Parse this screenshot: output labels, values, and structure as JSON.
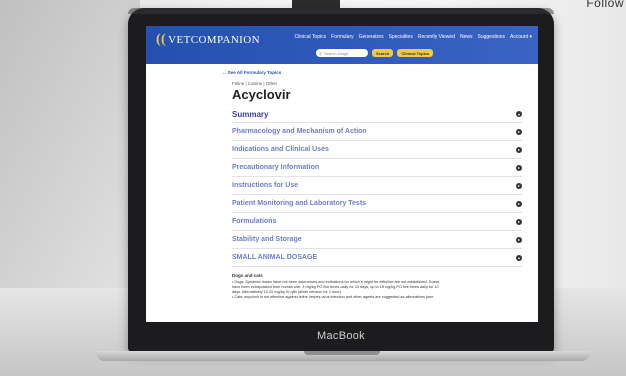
{
  "backdrop": {
    "corner_text": "Follow"
  },
  "device": {
    "brand": "MacBook"
  },
  "site": {
    "logo_text": "VETCOMPANION",
    "nav": [
      "Clinical Topics",
      "Formulary",
      "Generators",
      "Specialties",
      "Recently Viewed",
      "News",
      "Suggestions",
      "Account ▾"
    ],
    "search_placeholder": "Search Drugs",
    "search_button": "Search",
    "clinical_button": "Clinical Topics"
  },
  "page": {
    "back_link": "← See All Formulary Topics",
    "species": "Feline | Canine | Other",
    "title": "Acyclovir",
    "sections": [
      {
        "label": "Summary",
        "icon": "chevron-down-icon"
      },
      {
        "label": "Pharmacology and Mechanism of Action",
        "icon": "chevron-right-icon"
      },
      {
        "label": "Indications and Clinical Uses",
        "icon": "chevron-right-icon"
      },
      {
        "label": "Precautionary Information",
        "icon": "chevron-right-icon"
      },
      {
        "label": "Instructions for Use",
        "icon": "chevron-right-icon"
      },
      {
        "label": "Patient Monitoring and Laboratory Tests",
        "icon": "chevron-right-icon"
      },
      {
        "label": "Formulations",
        "icon": "chevron-right-icon"
      },
      {
        "label": "Stability and Storage",
        "icon": "chevron-right-icon"
      },
      {
        "label": "SMALL ANIMAL DOSAGE",
        "icon": "chevron-up-icon"
      }
    ],
    "dosage": {
      "heading": "Dogs and cats",
      "lines": [
        "• Dogs: Systemic doses have not been determined and indications for which it might be effective are not established. Doses",
        "have been extrapolated from human use: 3 mg/kg PO five times daily for 10 days, up to 15 mg/kg PO five times daily for 10",
        "days. Alternatively 10-20 mg/kg IV q8h (dilute infusion for 1 hour).",
        "• Cats: acyclovir is not effective against feline herpes virus infection and other agents are suggested as alternatives (see"
      ]
    }
  }
}
